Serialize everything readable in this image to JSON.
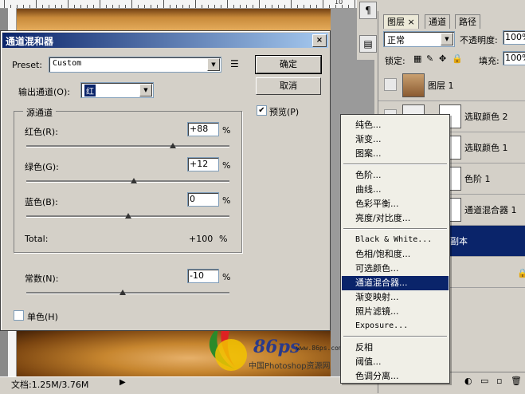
{
  "dialog": {
    "title": "通道混和器",
    "close_glyph": "×",
    "preset_label": "Preset:",
    "preset_value": "Custom",
    "output_channel_label": "输出通道(O):",
    "output_channel_value": "红",
    "source_group_label": "源通道",
    "channels": [
      {
        "label": "红色(R):",
        "value": "+88",
        "unit": "%",
        "level": 88
      },
      {
        "label": "绿色(G):",
        "value": "+12",
        "unit": "%",
        "level": 12
      },
      {
        "label": "蓝色(B):",
        "value": "0",
        "unit": "%",
        "level": 0
      }
    ],
    "total_label": "Total:",
    "total_value": "+100",
    "total_unit": "%",
    "constant_label": "常数(N):",
    "constant_value": "-10",
    "constant_unit": "%",
    "constant_level": -10,
    "monochrome_label": "单色(H)",
    "ok_label": "确定",
    "cancel_label": "取消",
    "preview_label": "预览(P)",
    "preview_checked": true
  },
  "layers_panel": {
    "tabs": [
      "图层",
      "通道",
      "路径"
    ],
    "tab_close_glyph": "×",
    "blend_mode": "正常",
    "opacity_label": "不透明度:",
    "opacity_value": "100%",
    "lock_label": "锁定:",
    "fill_label": "填充:",
    "fill_value": "100%",
    "layers": [
      {
        "name": "图层 1"
      },
      {
        "name": "选取颜色 2"
      },
      {
        "name": "选取颜色 1"
      },
      {
        "name": "色阶 1"
      },
      {
        "name": "通道混合器 1"
      },
      {
        "name": "副本"
      }
    ]
  },
  "context_menu": {
    "groups": [
      [
        "纯色...",
        "渐变...",
        "图案..."
      ],
      [
        "色阶...",
        "曲线...",
        "色彩平衡...",
        "亮度/对比度..."
      ],
      [
        "Black & White...",
        "色相/饱和度...",
        "可选颜色...",
        "通道混合器...",
        "渐变映射...",
        "照片滤镜...",
        "Exposure..."
      ],
      [
        "反相",
        "阈值...",
        "色调分离..."
      ]
    ],
    "highlighted": "通道混合器..."
  },
  "status": {
    "doc_info": "文档:1.25M/3.76M"
  },
  "ruler": {
    "number": "10"
  },
  "watermark": {
    "brand": "86ps",
    "url": "www.86ps.com",
    "subtitle": "中国Photoshop资源网"
  }
}
